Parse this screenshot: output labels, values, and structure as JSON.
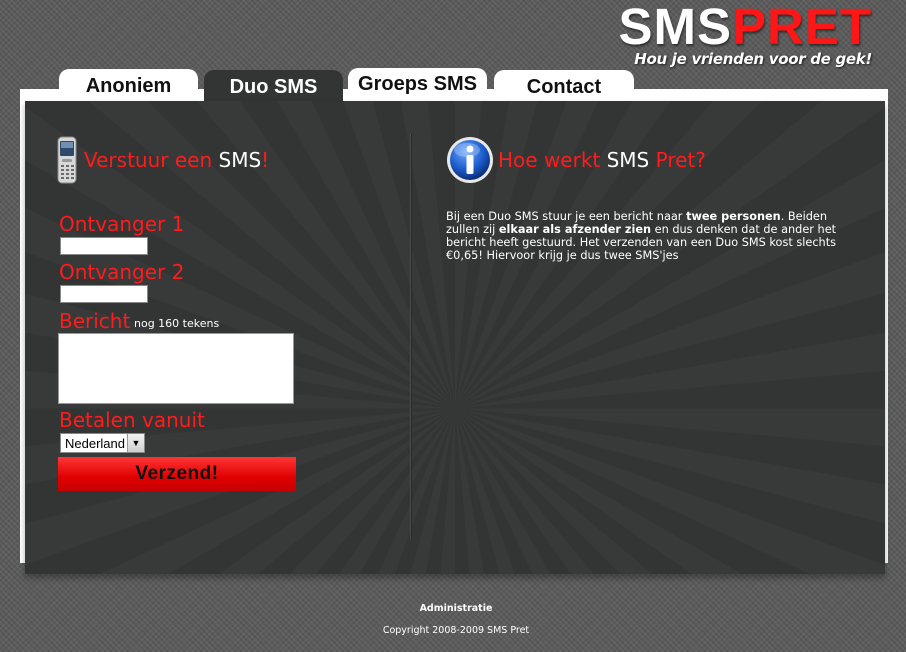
{
  "logo": {
    "sms": "SMS",
    "pret": "PRET",
    "tagline": "Hou je vrienden voor de gek!"
  },
  "tabs": [
    {
      "label": "Anoniem",
      "active": false
    },
    {
      "label": "Duo SMS",
      "active": true
    },
    {
      "label": "Groeps SMS",
      "active": false
    },
    {
      "label": "Contact",
      "active": false
    }
  ],
  "form": {
    "title_part1": "Verstuur een ",
    "title_part2": "SMS",
    "title_part3": "!",
    "recipient1_label": "Ontvanger 1",
    "recipient1_value": "",
    "recipient2_label": "Ontvanger 2",
    "recipient2_value": "",
    "message_label": "Bericht",
    "chars_left": "nog 160 tekens",
    "message_value": "",
    "pay_label": "Betalen vanuit",
    "pay_selected": "Nederland",
    "submit_label": "Verzend!"
  },
  "info": {
    "title_part1": "Hoe werkt ",
    "title_part2": "SMS",
    "title_part3": " Pret?",
    "body_1": "Bij een Duo SMS stuur je een bericht naar ",
    "body_bold_1": "twee personen",
    "body_2": ". Beiden zullen zij ",
    "body_bold_2": "elkaar als afzender zien",
    "body_3": " en dus denken dat de ander het bericht heeft gestuurd. Het verzenden van een Duo SMS kost slechts €0,65! Hiervoor krijg je dus twee SMS'jes"
  },
  "footer": {
    "admin_link": "Administratie",
    "copyright": "Copyright 2008-2009 SMS Pret"
  },
  "colors": {
    "accent_red": "#ff1c1c",
    "panel": "#333434",
    "background": "#5a5a5a"
  },
  "icons": {
    "phone": "mobile-phone-icon",
    "info": "info-icon",
    "dropdown": "chevron-down-icon"
  }
}
